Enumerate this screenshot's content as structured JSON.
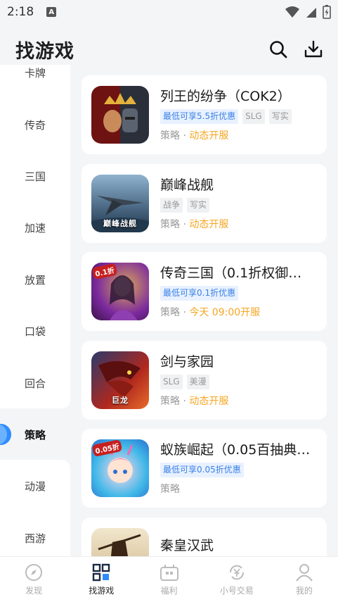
{
  "status_bar": {
    "time": "2:18",
    "notif_letter": "A"
  },
  "header": {
    "title": "找游戏"
  },
  "sidebar": {
    "items": [
      {
        "label": "卡牌"
      },
      {
        "label": "传奇"
      },
      {
        "label": "三国"
      },
      {
        "label": "加速"
      },
      {
        "label": "放置"
      },
      {
        "label": "口袋"
      },
      {
        "label": "回合"
      },
      {
        "label": "策略",
        "active": true
      },
      {
        "label": "动漫"
      },
      {
        "label": "西游"
      }
    ]
  },
  "games": [
    {
      "title": "列王的纷争（COK2）",
      "tags": [
        {
          "text": "最低可享5.5折优惠",
          "promo": true
        },
        {
          "text": "SLG"
        },
        {
          "text": "写实"
        }
      ],
      "category": "策略",
      "sep": " · ",
      "open_status": "动态开服",
      "icon_colors": [
        "#8b1a1a",
        "#d4a017"
      ]
    },
    {
      "title": "巅峰战舰",
      "tags": [
        {
          "text": "战争"
        },
        {
          "text": "写实"
        }
      ],
      "category": "策略",
      "sep": " · ",
      "open_status": "动态开服",
      "icon_caption": "巅峰战舰",
      "icon_colors": [
        "#5d7f9e",
        "#2c3e50"
      ]
    },
    {
      "title": "传奇三国（0.1折权御…",
      "tags": [
        {
          "text": "最低可享0.1折优惠",
          "promo": true
        }
      ],
      "category": "策略",
      "sep": " · ",
      "open_status": "今天 09:00开服",
      "icon_badge": "0.1折",
      "icon_colors": [
        "#7b2a9e",
        "#e0a040"
      ]
    },
    {
      "title": "剑与家园",
      "tags": [
        {
          "text": "SLG"
        },
        {
          "text": "美漫"
        }
      ],
      "category": "策略",
      "sep": " · ",
      "open_status": "动态开服",
      "icon_caption": "巨龙",
      "icon_colors": [
        "#b0281e",
        "#2b3a6b"
      ]
    },
    {
      "title": "蚁族崛起（0.05百抽典…",
      "tags": [
        {
          "text": "最低可享0.05折优惠",
          "promo": true
        }
      ],
      "category": "策略",
      "sep": "",
      "open_status": "",
      "icon_badge": "0.05折",
      "icon_colors": [
        "#40b8e8",
        "#f06ab0"
      ]
    },
    {
      "title": "秦皇汉武",
      "tags": [
        {
          "text": ""
        },
        {
          "text": ""
        },
        {
          "text": ""
        }
      ],
      "category": "",
      "sep": "",
      "open_status": "",
      "icon_colors": [
        "#e9dcc0",
        "#4a2e1a"
      ]
    }
  ],
  "bottom_nav": {
    "items": [
      {
        "label": "发现",
        "icon": "compass-icon"
      },
      {
        "label": "找游戏",
        "icon": "grid-icon",
        "active": true
      },
      {
        "label": "福利",
        "icon": "gift-box-icon"
      },
      {
        "label": "小号交易",
        "icon": "yuan-exchange-icon"
      },
      {
        "label": "我的",
        "icon": "user-icon"
      }
    ]
  },
  "colors": {
    "accent": "#2f8cff",
    "promo": "#3b82e6",
    "open": "#f5a623",
    "background": "#f4f5f7"
  }
}
